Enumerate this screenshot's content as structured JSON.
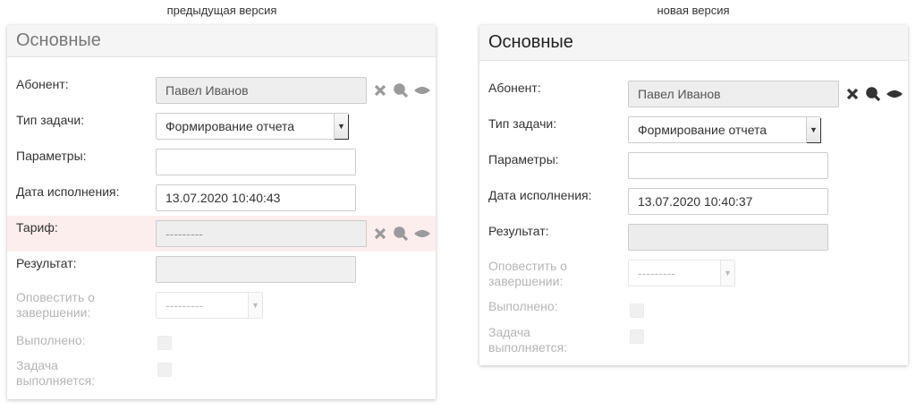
{
  "captions": {
    "old": "предыдущая версия",
    "new": "новая версия"
  },
  "old_panel": {
    "title": "Основные",
    "subscriber_label": "Абонент:",
    "subscriber_value": "Павел Иванов",
    "task_type_label": "Тип задачи:",
    "task_type_value": "Формирование отчета",
    "params_label": "Параметры:",
    "params_value": "",
    "date_label": "Дата исполнения:",
    "date_value": "13.07.2020 10:40:43",
    "tariff_label": "Тариф:",
    "tariff_value": "---------",
    "result_label": "Результат:",
    "result_value": "",
    "notify_label": "Оповестить о завершении:",
    "notify_value": "---------",
    "done_label": "Выполнено:",
    "running_label": "Задача выполняется:",
    "icon_color": "#9a9a9a",
    "highlight_color": "#fdeeee"
  },
  "new_panel": {
    "title": "Основные",
    "subscriber_label": "Абонент:",
    "subscriber_value": "Павел Иванов",
    "task_type_label": "Тип задачи:",
    "task_type_value": "Формирование отчета",
    "params_label": "Параметры:",
    "params_value": "",
    "date_label": "Дата исполнения:",
    "date_value": "13.07.2020 10:40:37",
    "result_label": "Результат:",
    "result_value": "",
    "notify_label": "Оповестить о завершении:",
    "notify_value": "---------",
    "done_label": "Выполнено:",
    "running_label": "Задача выполняется:",
    "icon_color": "#333333"
  },
  "icons": [
    "clear-icon",
    "search-icon",
    "view-icon"
  ]
}
